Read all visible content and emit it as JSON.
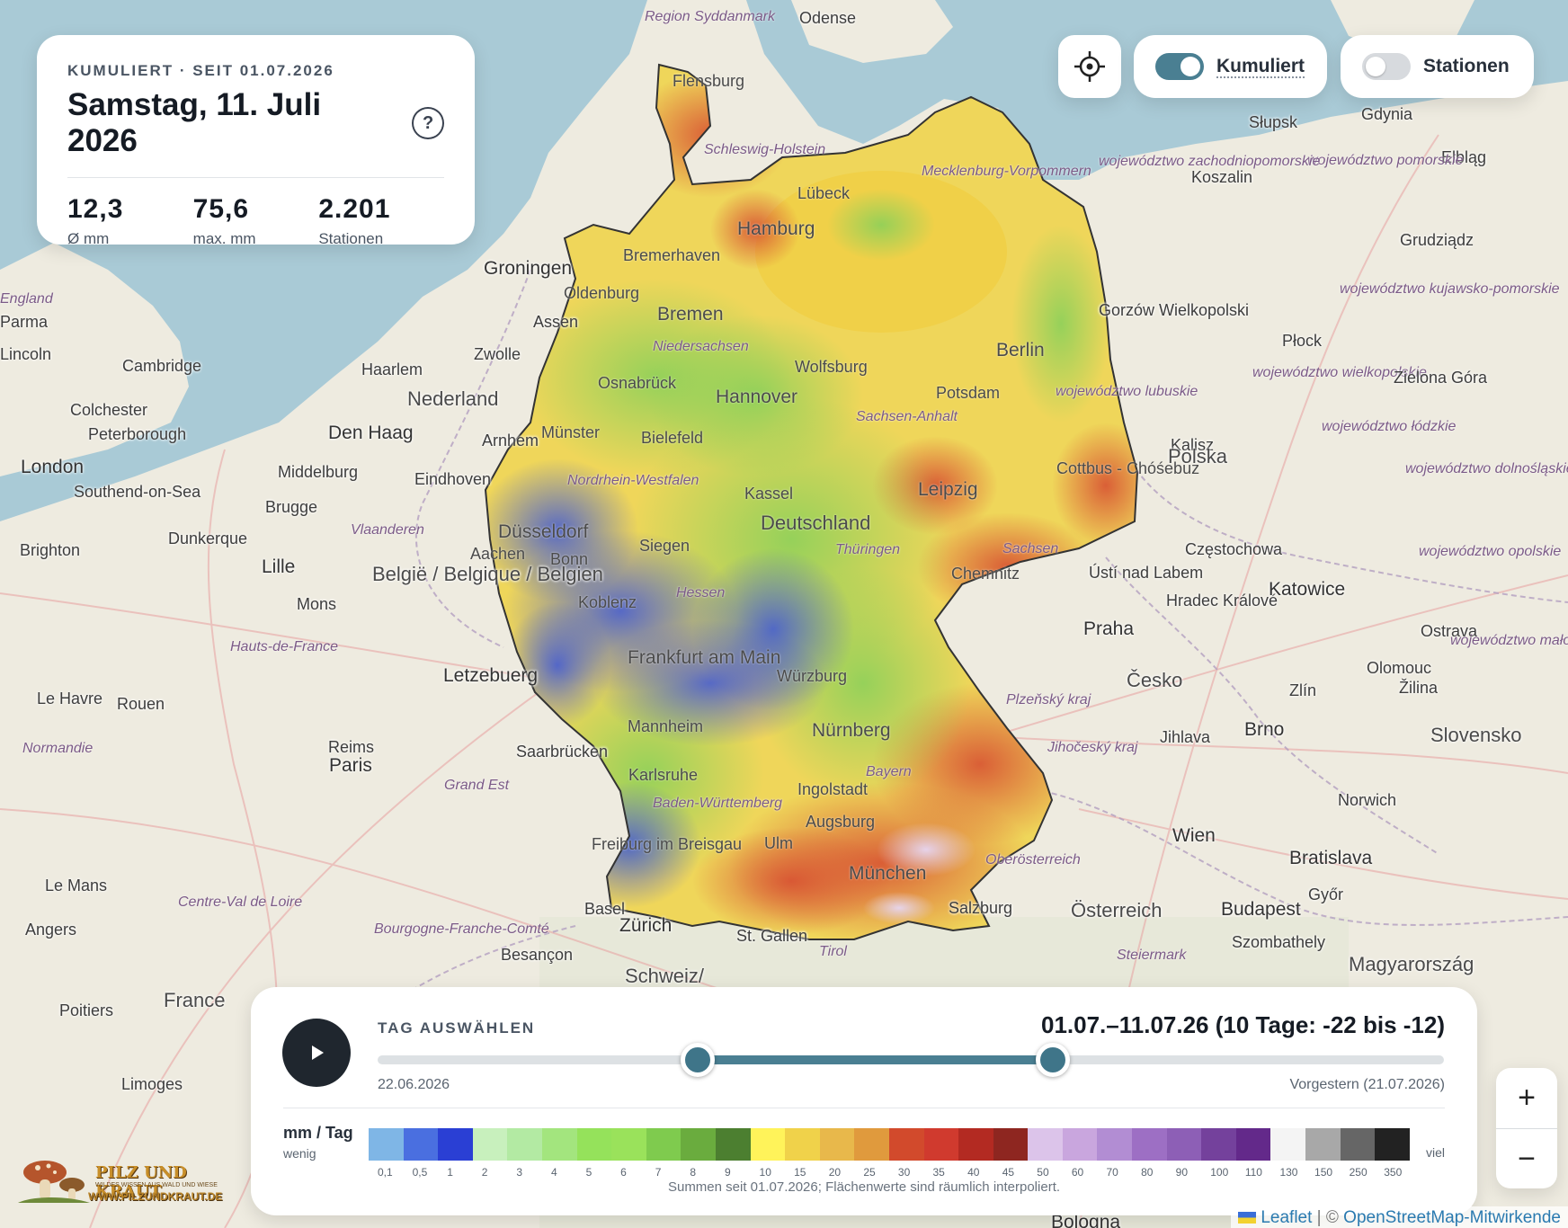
{
  "info": {
    "kicker": "KUMULIERT · SEIT 01.07.2026",
    "date": "Samstag, 11. Juli 2026",
    "help_label": "?",
    "stats": [
      {
        "value": "12,3",
        "label": "Ø mm"
      },
      {
        "value": "75,6",
        "label": "max. mm"
      },
      {
        "value": "2.201",
        "label": "Stationen"
      }
    ]
  },
  "controls": {
    "locate_icon": "crosshair-icon",
    "cumulative": {
      "label": "Kumuliert",
      "on": true
    },
    "stations": {
      "label": "Stationen",
      "on": false
    }
  },
  "timeline": {
    "label": "TAG AUSWÄHLEN",
    "range": "01.07.–11.07.26 (10 Tage: -22 bis -12)",
    "start_label": "22.06.2026",
    "end_label": "Vorgestern (21.07.2026)",
    "total_days": 30,
    "range_start_day": 9,
    "range_end_day": 19,
    "play_icon": "play-icon"
  },
  "legend": {
    "unit": "mm / Tag",
    "low": "wenig",
    "high": "viel",
    "note": "Summen seit 01.07.2026; Flächenwerte sind räumlich interpoliert.",
    "colors": [
      "#7fb6e6",
      "#4a6fe0",
      "#2a3fd4",
      "#c8f0bd",
      "#b3eaa3",
      "#a3e57e",
      "#95e25b",
      "#9ae25b",
      "#7fcb4e",
      "#6aac3e",
      "#4c7f30",
      "#fff35a",
      "#f0d24a",
      "#e8b84b",
      "#e09a3d",
      "#d24a2c",
      "#d03a2e",
      "#b32a22",
      "#8e2620",
      "#dcc4ea",
      "#c9a6de",
      "#b28dd3",
      "#9d6fc4",
      "#8d5fb6",
      "#74419c",
      "#63298a",
      "#f4f4f4",
      "#a8a8a8",
      "#666666",
      "#222222"
    ],
    "labels": [
      "0,1",
      "0,5",
      "1",
      "2",
      "3",
      "4",
      "5",
      "6",
      "7",
      "8",
      "9",
      "10",
      "15",
      "20",
      "25",
      "30",
      "35",
      "40",
      "45",
      "50",
      "60",
      "70",
      "80",
      "90",
      "100",
      "110",
      "130",
      "150",
      "250",
      "350"
    ]
  },
  "map": {
    "labels": [
      {
        "t": "Region Syddanmark",
        "c": "region"
      },
      {
        "t": "Odense",
        "c": ""
      },
      {
        "t": "Flensburg",
        "c": "inrad"
      },
      {
        "t": "Schleswig-Holstein",
        "c": "region"
      },
      {
        "t": "Lübeck",
        "c": "inrad"
      },
      {
        "t": "Hamburg",
        "c": "big inrad"
      },
      {
        "t": "Mecklenburg-Vorpommern",
        "c": "region"
      },
      {
        "t": "Bremerhaven",
        "c": "inrad"
      },
      {
        "t": "Groningen",
        "c": "big"
      },
      {
        "t": "Oldenburg",
        "c": "inrad"
      },
      {
        "t": "Bremen",
        "c": "big inrad"
      },
      {
        "t": "Assen",
        "c": ""
      },
      {
        "t": "Zwolle",
        "c": ""
      },
      {
        "t": "Niedersachsen",
        "c": "region"
      },
      {
        "t": "Wolfsburg",
        "c": "inrad"
      },
      {
        "t": "Berlin",
        "c": "big inrad"
      },
      {
        "t": "Haarlem",
        "c": ""
      },
      {
        "t": "Osnabrück",
        "c": "inrad"
      },
      {
        "t": "Hannover",
        "c": "big inrad"
      },
      {
        "t": "Potsdam",
        "c": "inrad"
      },
      {
        "t": "Nederland",
        "c": "country"
      },
      {
        "t": "Sachsen-Anhalt",
        "c": "region"
      },
      {
        "t": "Den Haag",
        "c": "big"
      },
      {
        "t": "Arnhem",
        "c": ""
      },
      {
        "t": "Münster",
        "c": "inrad"
      },
      {
        "t": "Bielefeld",
        "c": "inrad"
      },
      {
        "t": "London",
        "c": "big"
      },
      {
        "t": "Middelburg",
        "c": ""
      },
      {
        "t": "Eindhoven",
        "c": ""
      },
      {
        "t": "Nordrhein-Westfalen",
        "c": "region"
      },
      {
        "t": "Kassel",
        "c": "inrad"
      },
      {
        "t": "Leipzig",
        "c": "big inrad"
      },
      {
        "t": "Cottbus - Chóśebuz",
        "c": "inrad"
      },
      {
        "t": "Southend-on-Sea",
        "c": ""
      },
      {
        "t": "Brugge",
        "c": ""
      },
      {
        "t": "Vlaanderen",
        "c": "region"
      },
      {
        "t": "Düsseldorf",
        "c": "big inrad"
      },
      {
        "t": "Deutschland",
        "c": "country inrad"
      },
      {
        "t": "Thüringen",
        "c": "region"
      },
      {
        "t": "Sachsen",
        "c": "region"
      },
      {
        "t": "Dunkerque",
        "c": ""
      },
      {
        "t": "Aachen",
        "c": "inrad"
      },
      {
        "t": "Bonn",
        "c": "inrad"
      },
      {
        "t": "Siegen",
        "c": "inrad"
      },
      {
        "t": "Chemnitz",
        "c": "inrad"
      },
      {
        "t": "Ústí nad Labem",
        "c": ""
      },
      {
        "t": "Brighton",
        "c": ""
      },
      {
        "t": "Lille",
        "c": "big"
      },
      {
        "t": "België / Belgique / Belgien",
        "c": "country"
      },
      {
        "t": "Koblenz",
        "c": "inrad"
      },
      {
        "t": "Hessen",
        "c": "region"
      },
      {
        "t": "Mons",
        "c": ""
      },
      {
        "t": "Praha",
        "c": "big"
      },
      {
        "t": "Hradec Králové",
        "c": ""
      },
      {
        "t": "Hauts-de-France",
        "c": "region"
      },
      {
        "t": "Frankfurt am Main",
        "c": "big inrad"
      },
      {
        "t": "Würzburg",
        "c": "inrad"
      },
      {
        "t": "Letzebuerg",
        "c": "big"
      },
      {
        "t": "Česko",
        "c": "country"
      },
      {
        "t": "Le Havre",
        "c": ""
      },
      {
        "t": "Rouen",
        "c": ""
      },
      {
        "t": "Mannheim",
        "c": "inrad"
      },
      {
        "t": "Nürnberg",
        "c": "big inrad"
      },
      {
        "t": "Plzeňský kraj",
        "c": "region"
      },
      {
        "t": "Jihlava",
        "c": ""
      },
      {
        "t": "Brno",
        "c": "big"
      },
      {
        "t": "Normandie",
        "c": "region"
      },
      {
        "t": "Reims",
        "c": ""
      },
      {
        "t": "Saarbrücken",
        "c": ""
      },
      {
        "t": "Jihočeský kraj",
        "c": "region"
      },
      {
        "t": "Paris",
        "c": "big"
      },
      {
        "t": "Karlsruhe",
        "c": "inrad"
      },
      {
        "t": "Bayern",
        "c": "region"
      },
      {
        "t": "Grand Est",
        "c": "region"
      },
      {
        "t": "Ingolstadt",
        "c": "inrad"
      },
      {
        "t": "Baden-Württemberg",
        "c": "region"
      },
      {
        "t": "Augsburg",
        "c": "inrad"
      },
      {
        "t": "Ulm",
        "c": "inrad"
      },
      {
        "t": "Freiburg im Breisgau",
        "c": "inrad"
      },
      {
        "t": "München",
        "c": "big inrad"
      },
      {
        "t": "Oberösterreich",
        "c": "region"
      },
      {
        "t": "Wien",
        "c": "big"
      },
      {
        "t": "Bratislava",
        "c": "big"
      },
      {
        "t": "Le Mans",
        "c": ""
      },
      {
        "t": "Centre-Val de Loire",
        "c": "region"
      },
      {
        "t": "Basel",
        "c": ""
      },
      {
        "t": "Salzburg",
        "c": ""
      },
      {
        "t": "Österreich",
        "c": "country"
      },
      {
        "t": "Győr",
        "c": ""
      },
      {
        "t": "Budapest",
        "c": "big"
      },
      {
        "t": "Angers",
        "c": ""
      },
      {
        "t": "Zürich",
        "c": "big"
      },
      {
        "t": "St. Gallen",
        "c": ""
      },
      {
        "t": "Tirol",
        "c": "region"
      },
      {
        "t": "Bourgogne-Franche-Comté",
        "c": "region"
      },
      {
        "t": "Besançon",
        "c": ""
      },
      {
        "t": "Szombathely",
        "c": ""
      },
      {
        "t": "Steiermark",
        "c": "region"
      },
      {
        "t": "Magyarország",
        "c": "country"
      },
      {
        "t": "Schweiz/",
        "c": "country"
      },
      {
        "t": "France",
        "c": "country"
      },
      {
        "t": "Poitiers",
        "c": ""
      },
      {
        "t": "Limoges",
        "c": ""
      },
      {
        "t": "Słupsk",
        "c": ""
      },
      {
        "t": "Gdynia",
        "c": ""
      },
      {
        "t": "Koszalin",
        "c": ""
      },
      {
        "t": "Elbląg",
        "c": ""
      },
      {
        "t": "województwo pomorskie",
        "c": "region"
      },
      {
        "t": "województwo zachodniopomorskie",
        "c": "region"
      },
      {
        "t": "Grudziądz",
        "c": ""
      },
      {
        "t": "Gorzów Wielkopolski",
        "c": ""
      },
      {
        "t": "województwo kujawsko-pomorskie",
        "c": "region"
      },
      {
        "t": "województwo lubuskie",
        "c": "region"
      },
      {
        "t": "województwo wielkopolskie",
        "c": "region"
      },
      {
        "t": "Płock",
        "c": ""
      },
      {
        "t": "Zielona Góra",
        "c": ""
      },
      {
        "t": "Kalisz",
        "c": ""
      },
      {
        "t": "Polska",
        "c": "country"
      },
      {
        "t": "województwo łódzkie",
        "c": "region"
      },
      {
        "t": "województwo dolnośląskie",
        "c": "region"
      },
      {
        "t": "Częstochowa",
        "c": ""
      },
      {
        "t": "województwo opolskie",
        "c": "region"
      },
      {
        "t": "Katowice",
        "c": "big"
      },
      {
        "t": "Ostrava",
        "c": ""
      },
      {
        "t": "Olomouc",
        "c": ""
      },
      {
        "t": "Zlín",
        "c": ""
      },
      {
        "t": "Žilina",
        "c": ""
      },
      {
        "t": "województwo małopolskie",
        "c": "region"
      },
      {
        "t": "Slovensko",
        "c": "country"
      },
      {
        "t": "Norwich",
        "c": ""
      },
      {
        "t": "Cambridge",
        "c": ""
      },
      {
        "t": "Colchester",
        "c": ""
      },
      {
        "t": "Peterborough",
        "c": ""
      },
      {
        "t": "Lincoln",
        "c": ""
      },
      {
        "t": "England",
        "c": "region"
      },
      {
        "t": "Parma",
        "c": ""
      },
      {
        "t": "Bologna",
        "c": "big"
      }
    ]
  },
  "zoom": {
    "in": "+",
    "out": "−"
  },
  "logo": {
    "name": "PILZ UND KRAUT",
    "tag": "WILDES WISSEN AUS WALD UND WIESE",
    "url": "WWW.PILZUNDKRAUT.DE"
  },
  "attribution": {
    "leaflet": "Leaflet",
    "sep": " | © ",
    "osm": "OpenStreetMap-Mitwirkende"
  }
}
